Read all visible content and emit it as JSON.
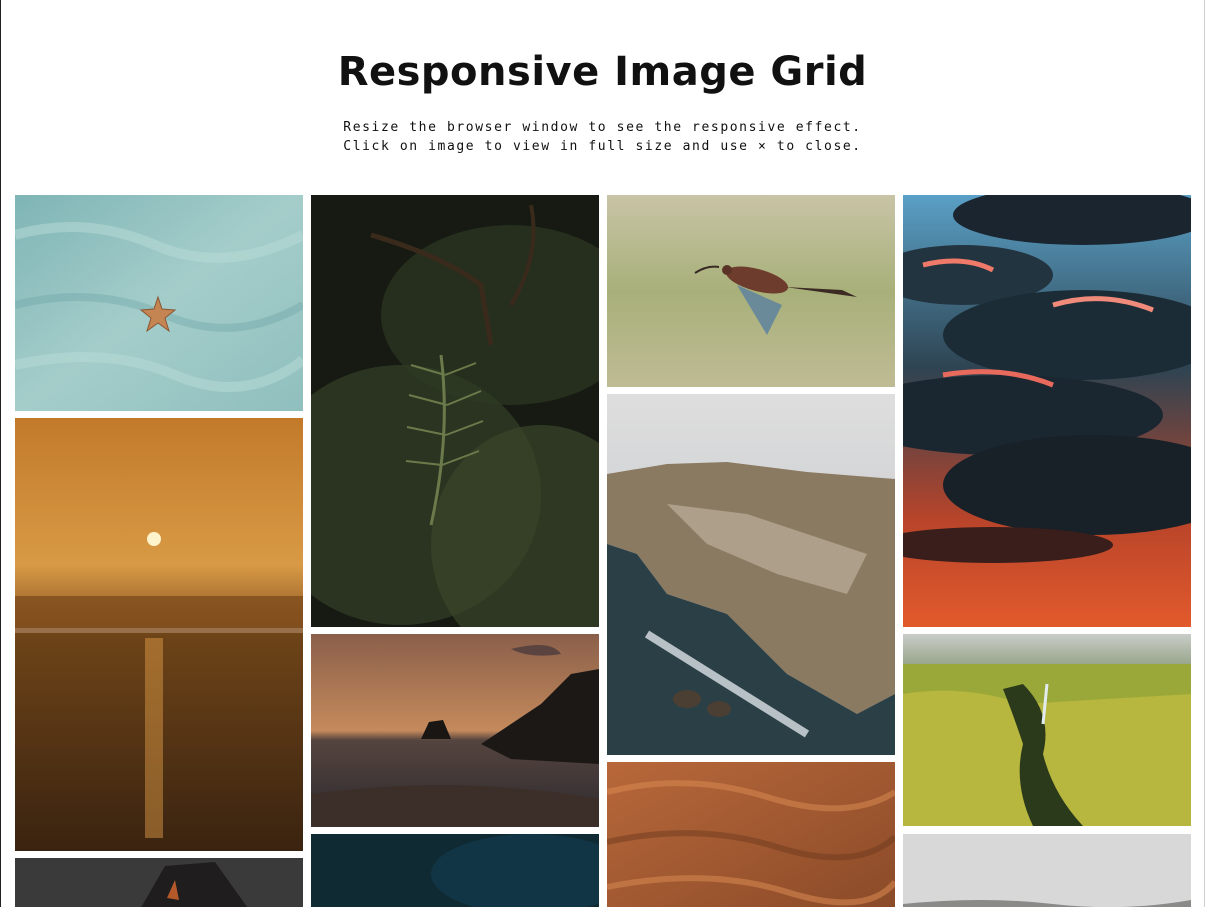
{
  "page": {
    "title": "Responsive Image Grid",
    "subtitle_line1": "Resize the browser window to see the responsive effect.",
    "subtitle_line2": "Click on image to view in full size and use × to close."
  },
  "gallery": {
    "columns": [
      {
        "images": [
          {
            "subject": "starfish on sand",
            "name": "starfish-sand"
          },
          {
            "subject": "sunset over sea",
            "name": "sea-sunset"
          },
          {
            "subject": "dark rock",
            "name": "dark-rock"
          }
        ]
      },
      {
        "images": [
          {
            "subject": "fern leaves",
            "name": "fern"
          },
          {
            "subject": "coast at dusk",
            "name": "dusk-coast"
          },
          {
            "subject": "dark water",
            "name": "dark-water"
          }
        ]
      },
      {
        "images": [
          {
            "subject": "ibis in flight",
            "name": "ibis-flight"
          },
          {
            "subject": "sea cliffs",
            "name": "sea-cliffs"
          },
          {
            "subject": "sand dunes",
            "name": "sand-dunes"
          }
        ]
      },
      {
        "images": [
          {
            "subject": "dramatic red sky",
            "name": "red-sky"
          },
          {
            "subject": "green canyon",
            "name": "green-canyon"
          },
          {
            "subject": "misty hills",
            "name": "misty-hills"
          }
        ]
      }
    ]
  },
  "colors": {
    "background": "#ffffff",
    "text": "#111111"
  }
}
